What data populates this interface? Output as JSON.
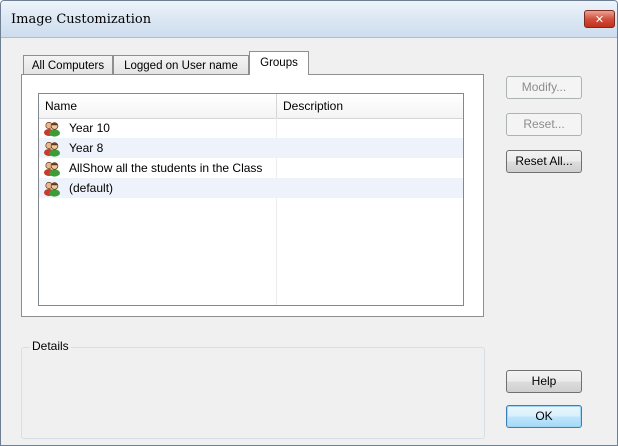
{
  "window": {
    "title": "Image Customization"
  },
  "tabs": [
    {
      "label": "All Computers",
      "active": false
    },
    {
      "label": "Logged on User name",
      "active": false
    },
    {
      "label": "Groups",
      "active": true
    }
  ],
  "list": {
    "columns": [
      "Name",
      "Description"
    ],
    "rows": [
      {
        "name": "Year 10",
        "description": "",
        "icon": "user-group-icon"
      },
      {
        "name": "Year 8",
        "description": "",
        "icon": "user-group-icon"
      },
      {
        "name": "AllShow all the students in the Class",
        "description": "",
        "icon": "user-group-icon"
      },
      {
        "name": "(default)",
        "description": "",
        "icon": "user-group-icon"
      }
    ]
  },
  "buttons": {
    "modify": {
      "label": "Modify...",
      "enabled": false
    },
    "reset": {
      "label": "Reset...",
      "enabled": false
    },
    "reset_all": {
      "label": "Reset All...",
      "enabled": true
    },
    "help": {
      "label": "Help",
      "enabled": true
    },
    "ok": {
      "label": "OK",
      "enabled": true
    }
  },
  "details": {
    "label": "Details"
  },
  "colors": {
    "close_button": "#c7402c",
    "row_alt": "#eef3fb",
    "default_button_border": "#3c7fb1"
  }
}
